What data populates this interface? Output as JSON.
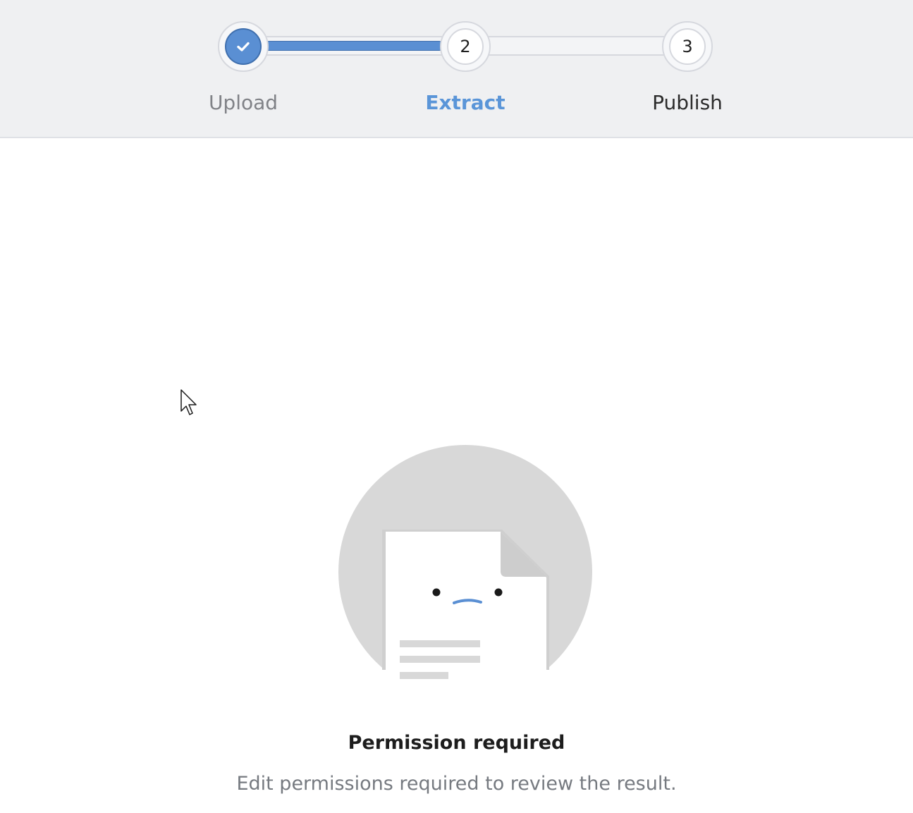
{
  "stepper": {
    "steps": [
      {
        "label": "Upload",
        "number": "1",
        "state": "completed"
      },
      {
        "label": "Extract",
        "number": "2",
        "state": "active"
      },
      {
        "label": "Publish",
        "number": "3",
        "state": "pending"
      }
    ],
    "progress_fraction": 0.5
  },
  "illustration": {
    "name": "sad-document-icon"
  },
  "empty_state": {
    "title": "Permission required",
    "description": "Edit permissions required to review the result."
  },
  "colors": {
    "accent": "#5a8fd3",
    "active_label": "#5a95d8",
    "header_bg": "#eff0f2"
  }
}
